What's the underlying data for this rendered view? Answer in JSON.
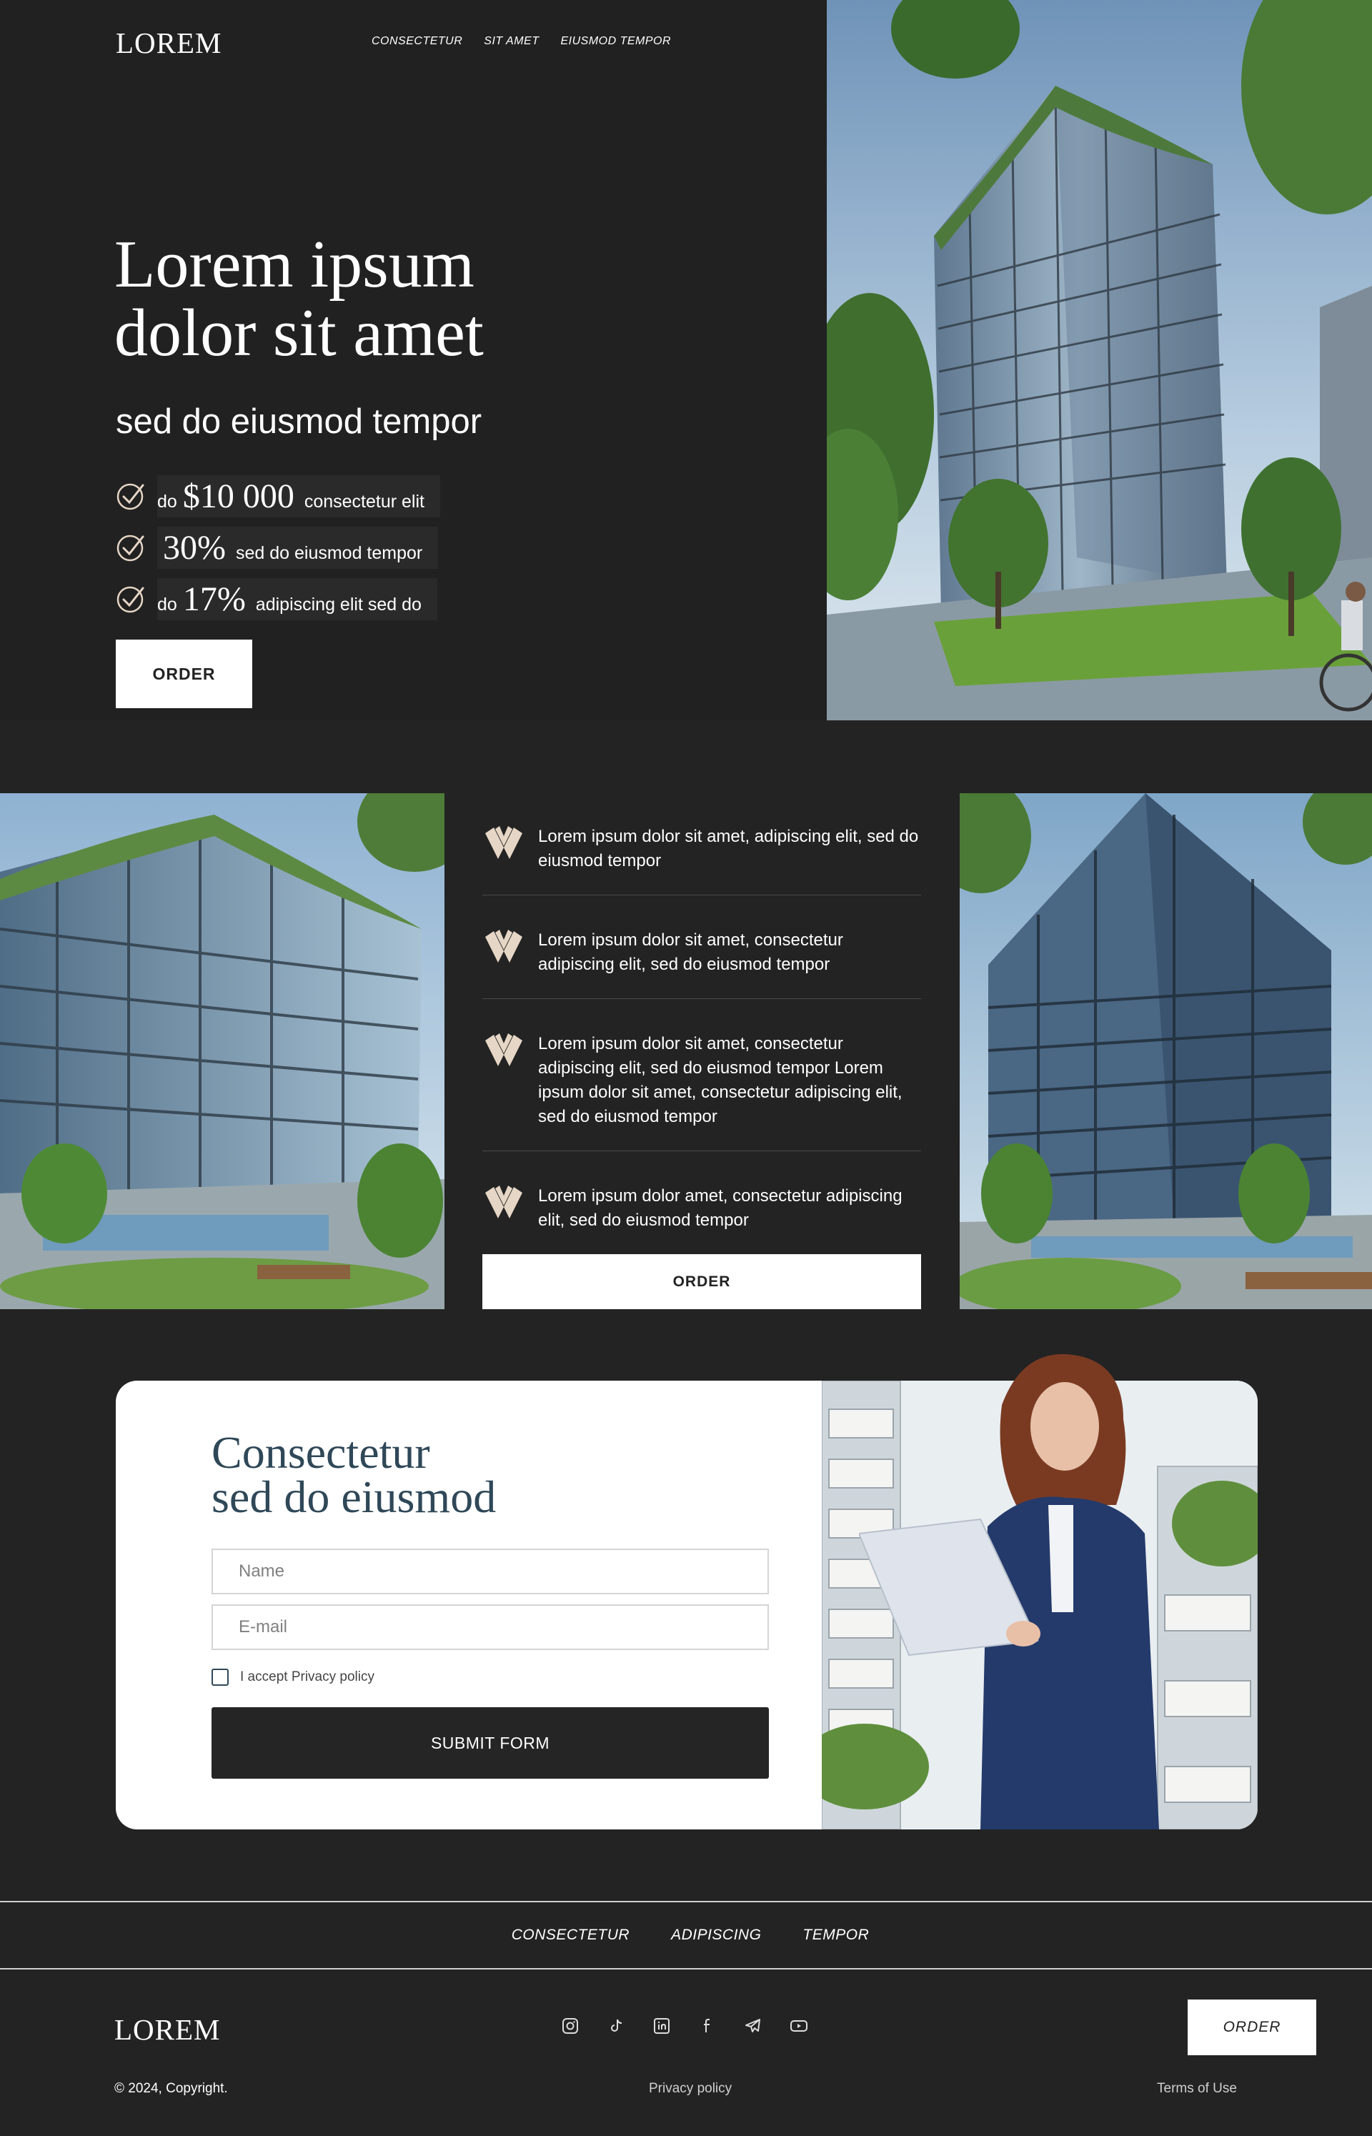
{
  "header": {
    "logo": "LOREM",
    "nav": [
      "CONSECTETUR",
      "SIT AMET",
      "EIUSMOD TEMPOR"
    ]
  },
  "hero": {
    "title_line1": "Lorem ipsum",
    "title_line2": "dolor sit amet",
    "subtitle": "sed do eiusmod tempor",
    "benefits": [
      {
        "pre": "do",
        "big": "$10 000",
        "text": "consectetur elit"
      },
      {
        "pre": "",
        "big": "30%",
        "text": "sed do eiusmod tempor"
      },
      {
        "pre": "do",
        "big": "17%",
        "text": "adipiscing elit sed do"
      }
    ],
    "order_label": "ORDER"
  },
  "features": {
    "items": [
      "Lorem ipsum dolor sit amet, adipiscing elit, sed do eiusmod tempor",
      "Lorem ipsum dolor sit amet, consectetur adipiscing elit, sed do eiusmod tempor",
      "Lorem ipsum dolor sit amet, consectetur adipiscing elit, sed do eiusmod tempor Lorem ipsum dolor sit amet, consectetur adipiscing elit, sed do eiusmod tempor",
      "Lorem ipsum dolor amet, consectetur adipiscing elit, sed do eiusmod tempor"
    ],
    "order_label": "ORDER"
  },
  "form": {
    "title_line1": "Consectetur",
    "title_line2": "sed do eiusmod",
    "name_placeholder": "Name",
    "email_placeholder": "E-mail",
    "privacy_label": "I accept Privacy policy",
    "submit_label": "SUBMIT FORM"
  },
  "footer": {
    "nav": [
      "CONSECTETUR",
      "ADIPISCING",
      "TEMPOR"
    ],
    "logo": "LOREM",
    "socials": [
      "instagram-icon",
      "tiktok-icon",
      "linkedin-icon",
      "facebook-icon",
      "telegram-icon",
      "youtube-icon"
    ],
    "order_label": "ORDER",
    "copyright": "© 2024, Copyright.",
    "privacy_link": "Privacy policy",
    "terms_link": "Terms of Use"
  },
  "colors": {
    "background": "#232323",
    "accent_dark": "#2f4858",
    "icon_beige": "#e6d6c6"
  }
}
